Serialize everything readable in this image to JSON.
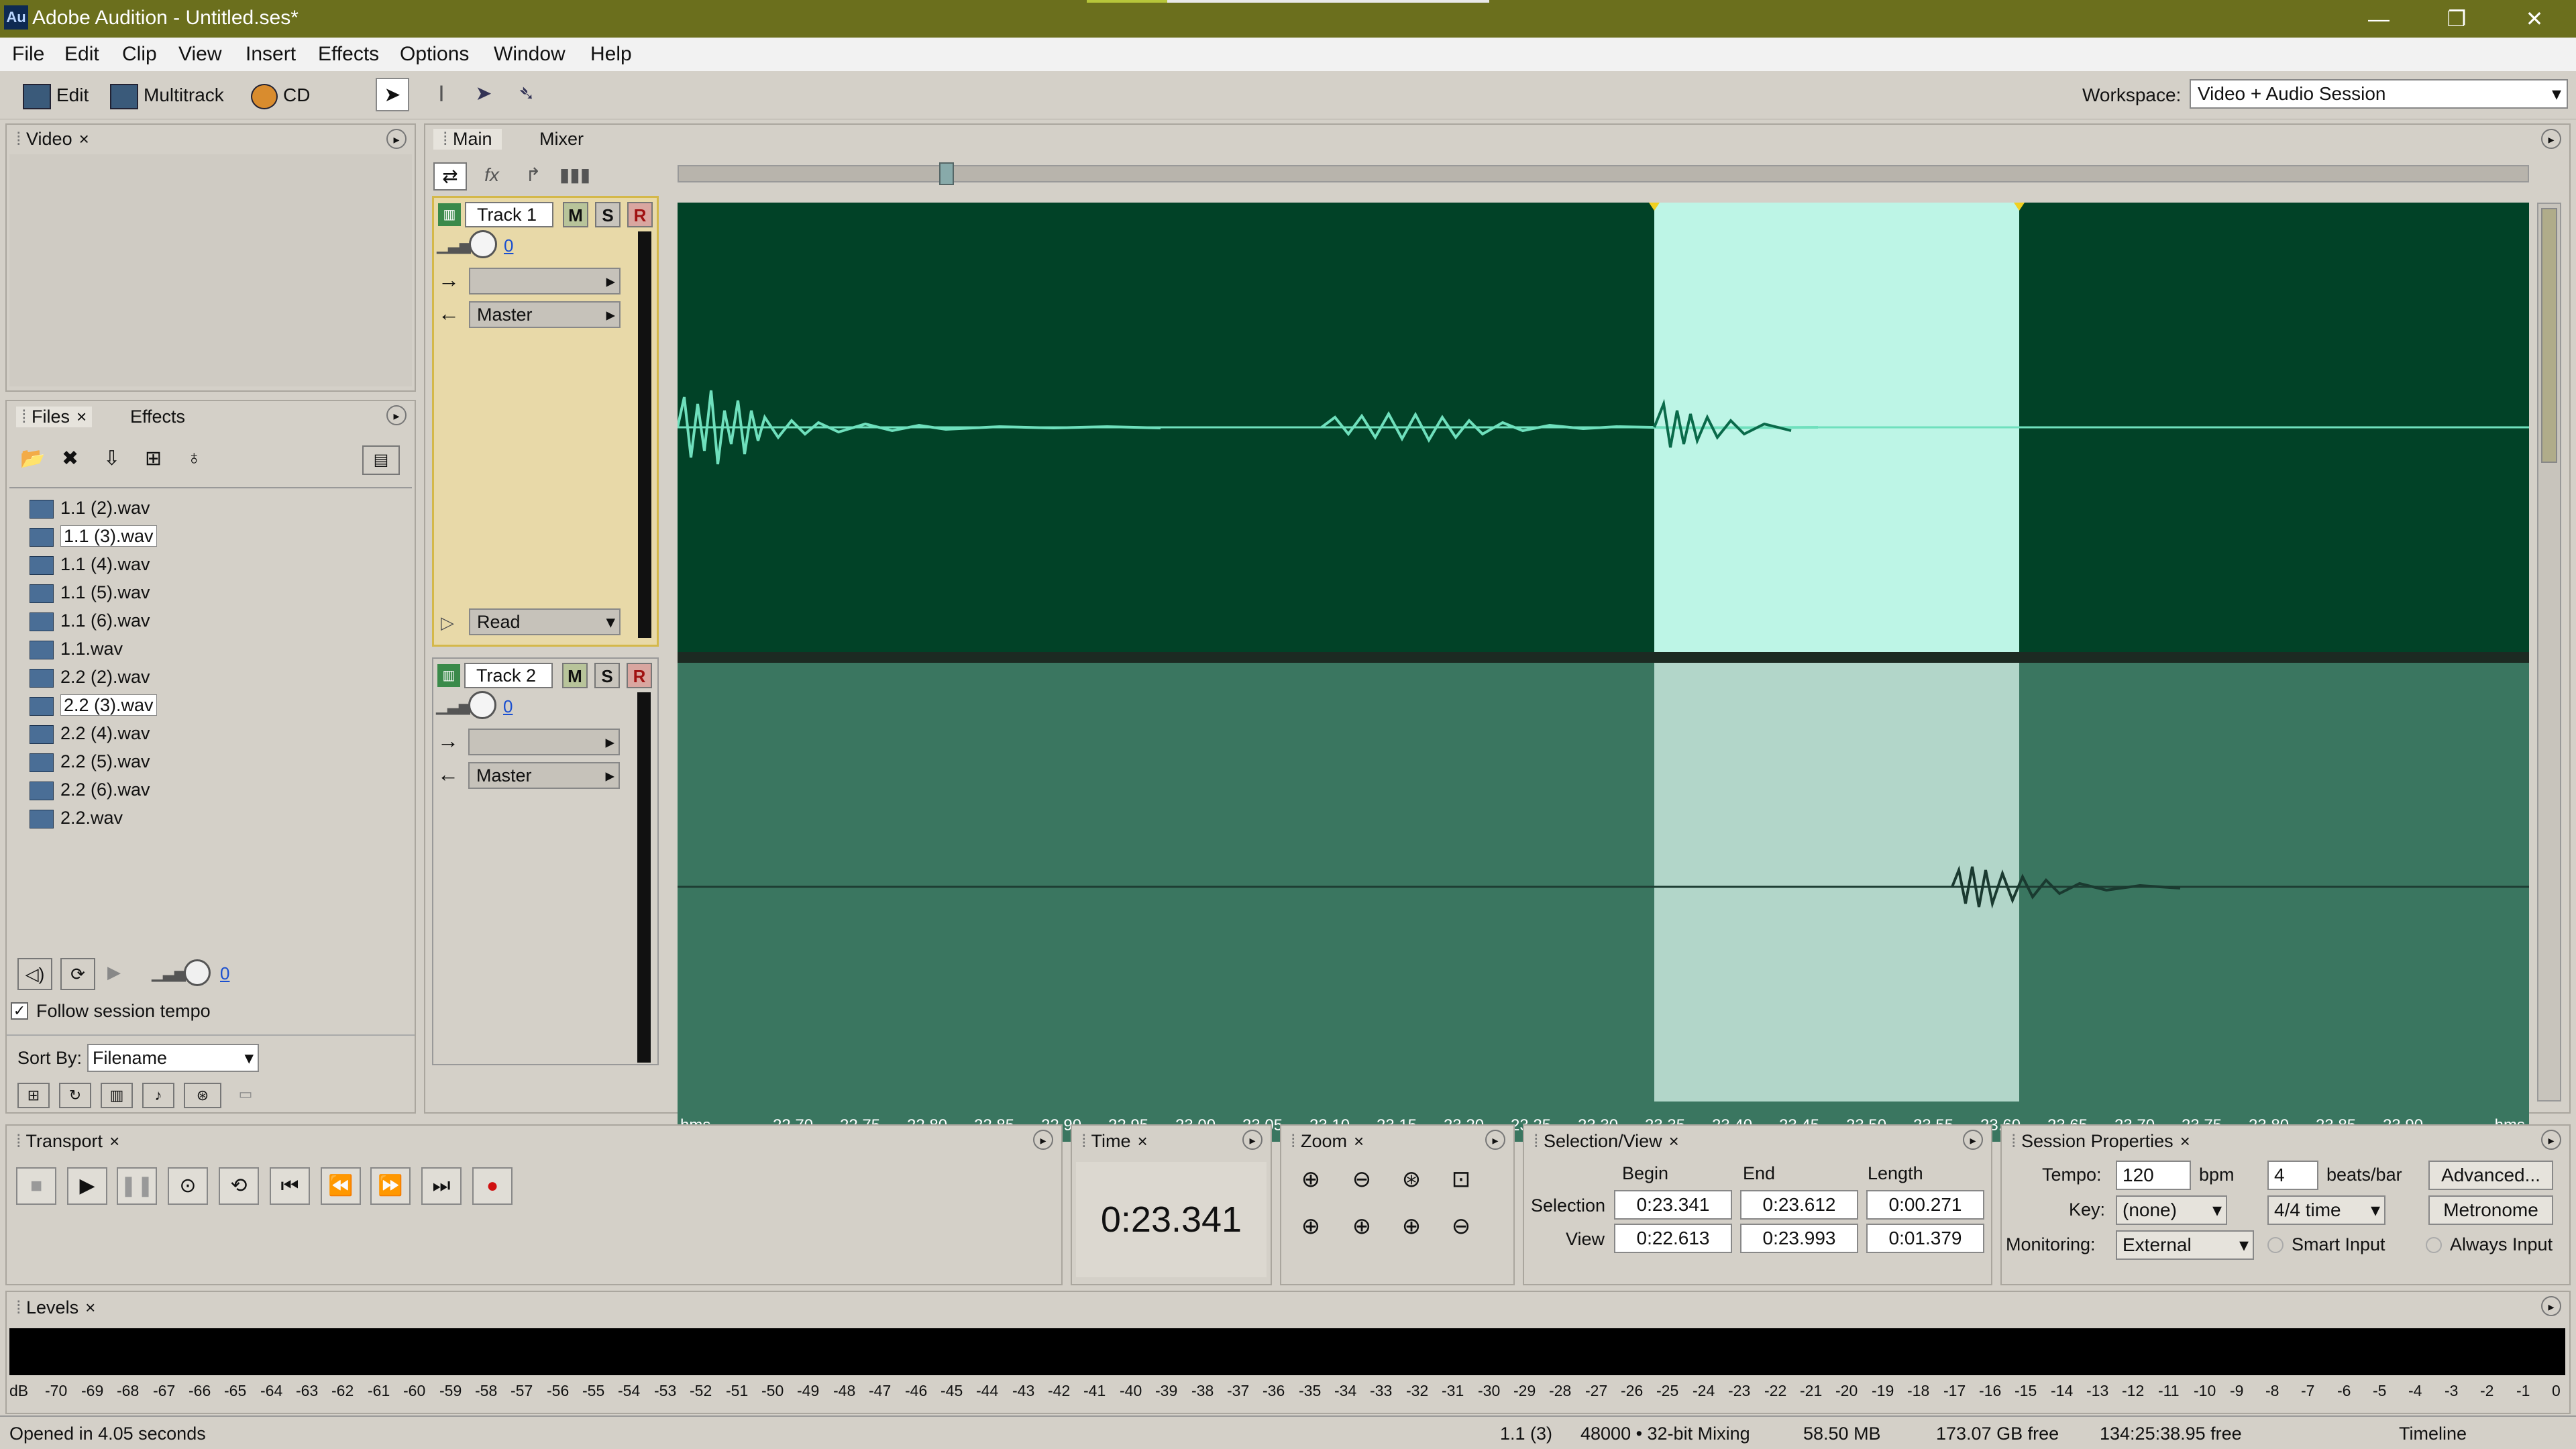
{
  "window": {
    "title": "Adobe Audition - Untitled.ses*",
    "app_icon": "Au",
    "minimize": "—",
    "maximize": "❐",
    "close": "✕"
  },
  "menu": [
    "File",
    "Edit",
    "Clip",
    "View",
    "Insert",
    "Effects",
    "Options",
    "Window",
    "Help"
  ],
  "toolbar": {
    "edit": "Edit",
    "multitrack": "Multitrack",
    "cd": "CD",
    "workspace_label": "Workspace:",
    "workspace_value": "Video + Audio Session"
  },
  "video_panel": {
    "tab": "Video"
  },
  "files_panel": {
    "tabs": [
      "Files",
      "Effects"
    ],
    "files": [
      "1.1 (2).wav",
      "1.1 (3).wav",
      "1.1 (4).wav",
      "1.1 (5).wav",
      "1.1 (6).wav",
      "1.1.wav",
      "2.2 (2).wav",
      "2.2 (3).wav",
      "2.2 (4).wav",
      "2.2 (5).wav",
      "2.2 (6).wav",
      "2.2.wav"
    ],
    "selected": [
      "1.1 (3).wav",
      "2.2 (3).wav"
    ],
    "volume_value": "0",
    "follow_tempo": "Follow session tempo",
    "sort_by_label": "Sort By:",
    "sort_by_value": "Filename"
  },
  "main_panel": {
    "tabs": [
      "Main",
      "Mixer"
    ],
    "tracks": [
      {
        "name": "Track 1",
        "m": "M",
        "s": "S",
        "r": "R",
        "volume": "0",
        "output": "Master",
        "automation": "Read"
      },
      {
        "name": "Track 2",
        "m": "M",
        "s": "S",
        "r": "R",
        "volume": "0",
        "output": "Master"
      }
    ],
    "ruler": {
      "unit": "hms",
      "labels": [
        "22.70",
        "22.75",
        "22.80",
        "22.85",
        "22.90",
        "22.95",
        "23.00",
        "23.05",
        "23.10",
        "23.15",
        "23.20",
        "23.25",
        "23.30",
        "23.35",
        "23.40",
        "23.45",
        "23.50",
        "23.55",
        "23.60",
        "23.65",
        "23.70",
        "23.75",
        "23.80",
        "23.85",
        "23.90"
      ]
    }
  },
  "transport": {
    "tab": "Transport"
  },
  "time_panel": {
    "tab": "Time",
    "value": "0:23.341"
  },
  "zoom_panel": {
    "tab": "Zoom"
  },
  "selection_view": {
    "tab": "Selection/View",
    "headers": [
      "Begin",
      "End",
      "Length"
    ],
    "selection_label": "Selection",
    "view_label": "View",
    "selection": [
      "0:23.341",
      "0:23.612",
      "0:00.271"
    ],
    "view": [
      "0:22.613",
      "0:23.993",
      "0:01.379"
    ]
  },
  "session_properties": {
    "tab": "Session Properties",
    "tempo_label": "Tempo:",
    "tempo_value": "120",
    "bpm": "bpm",
    "beats_value": "4",
    "beats_label": "beats/bar",
    "advanced": "Advanced...",
    "key_label": "Key:",
    "key_value": "(none)",
    "time_sig": "4/4 time",
    "metronome": "Metronome",
    "monitoring_label": "Monitoring:",
    "monitoring_value": "External",
    "smart_input": "Smart Input",
    "always_input": "Always Input"
  },
  "levels": {
    "tab": "Levels",
    "scale": [
      "dB",
      "-70",
      "-69",
      "-68",
      "-67",
      "-66",
      "-65",
      "-64",
      "-63",
      "-62",
      "-61",
      "-60",
      "-59",
      "-58",
      "-57",
      "-56",
      "-55",
      "-54",
      "-53",
      "-52",
      "-51",
      "-50",
      "-49",
      "-48",
      "-47",
      "-46",
      "-45",
      "-44",
      "-43",
      "-42",
      "-41",
      "-40",
      "-39",
      "-38",
      "-37",
      "-36",
      "-35",
      "-34",
      "-33",
      "-32",
      "-31",
      "-30",
      "-29",
      "-28",
      "-27",
      "-26",
      "-25",
      "-24",
      "-23",
      "-22",
      "-21",
      "-20",
      "-19",
      "-18",
      "-17",
      "-16",
      "-15",
      "-14",
      "-13",
      "-12",
      "-11",
      "-10",
      "-9",
      "-8",
      "-7",
      "-6",
      "-5",
      "-4",
      "-3",
      "-2",
      "-1",
      "0"
    ]
  },
  "status": {
    "message": "Opened in 4.05 seconds",
    "clip": "1.1 (3)",
    "format": "48000 • 32-bit Mixing",
    "memory": "58.50 MB",
    "free": "173.07 GB free",
    "duration": "134:25:38.95 free",
    "view": "Timeline"
  },
  "colors": {
    "title_bg": "#6b6f1d",
    "wave_track1": "#014227",
    "wave_track2": "#3a7660",
    "selection1": "#bdf5e6",
    "selection2": "#b2d6c9",
    "waveform": "#6fe0bd"
  }
}
